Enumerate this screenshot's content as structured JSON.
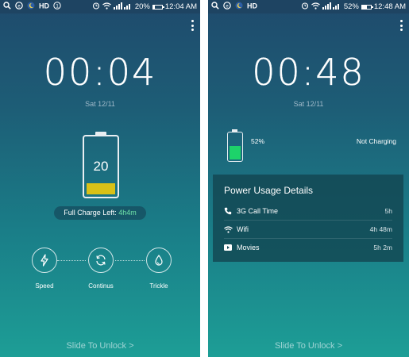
{
  "left": {
    "statusbar": {
      "left_icons": [
        "search-icon",
        "sim-icon",
        "moon-icon",
        "hd-icon",
        "notification-one-icon"
      ],
      "battery": "20%",
      "battery_level": 0.2,
      "time": "12:04 AM"
    },
    "clock": "00:04",
    "date": "Sat 12/11",
    "battery": {
      "percent": "20",
      "level": 0.2,
      "fill_color": "#d9c117"
    },
    "full_charge": {
      "label": "Full Charge Left: ",
      "value": "4h4m"
    },
    "modes": [
      {
        "label": "Speed",
        "icon": "lightning-icon"
      },
      {
        "label": "Continus",
        "icon": "refresh-icon"
      },
      {
        "label": "Trickle",
        "icon": "drop-icon"
      }
    ],
    "slide_to_unlock": "Slide To Unlock >"
  },
  "right": {
    "statusbar": {
      "left_icons": [
        "search-icon",
        "sim-icon",
        "moon-icon",
        "hd-icon"
      ],
      "battery": "52%",
      "battery_level": 0.52,
      "time": "12:48 AM"
    },
    "clock": "00:48",
    "date": "Sat 12/11",
    "battery": {
      "percent": "52%",
      "level": 0.52,
      "status": "Not Charging",
      "fill_color": "#1dd36a"
    },
    "power_usage": {
      "title": "Power Usage Details",
      "rows": [
        {
          "icon": "phone-icon",
          "label": "3G Call Time",
          "value": "5h"
        },
        {
          "icon": "wifi-icon",
          "label": "Wifi",
          "value": "4h 48m"
        },
        {
          "icon": "video-icon",
          "label": "Movies",
          "value": "5h 2m"
        }
      ]
    },
    "slide_to_unlock": "Slide To Unlock >"
  }
}
